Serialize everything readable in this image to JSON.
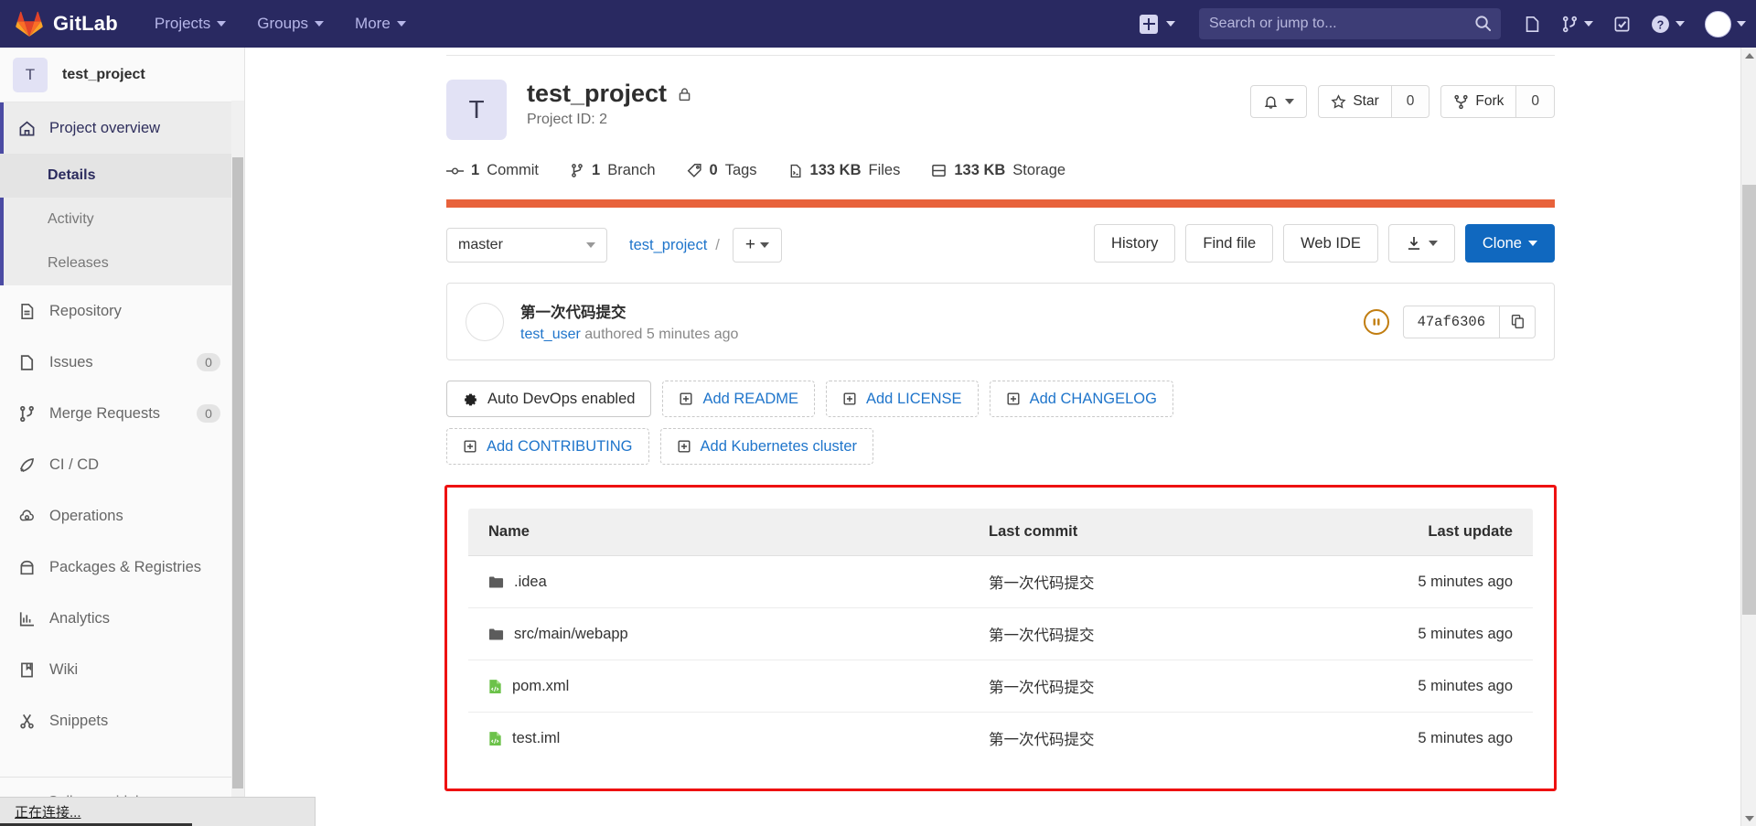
{
  "navbar": {
    "brand": "GitLab",
    "menu": [
      {
        "label": "Projects",
        "name": "nav-projects"
      },
      {
        "label": "Groups",
        "name": "nav-groups"
      },
      {
        "label": "More",
        "name": "nav-more"
      }
    ],
    "search": {
      "placeholder": "Search or jump to...",
      "value": ""
    },
    "icons": [
      "plus-square-icon",
      "search-icon",
      "issues-icon",
      "merge-request-icon",
      "todo-icon",
      "help-icon",
      "user-avatar-icon"
    ]
  },
  "sidebar": {
    "project": {
      "initial": "T",
      "name": "test_project"
    },
    "items": [
      {
        "label": "Project overview",
        "icon": "home-icon",
        "active": true,
        "badge": ""
      },
      {
        "label": "Repository",
        "icon": "document-icon",
        "active": false,
        "badge": ""
      },
      {
        "label": "Issues",
        "icon": "issues-icon",
        "active": false,
        "badge": "0"
      },
      {
        "label": "Merge Requests",
        "icon": "merge-request-icon",
        "active": false,
        "badge": "0"
      },
      {
        "label": "CI / CD",
        "icon": "rocket-icon",
        "active": false,
        "badge": ""
      },
      {
        "label": "Operations",
        "icon": "cloud-gear-icon",
        "active": false,
        "badge": ""
      },
      {
        "label": "Packages & Registries",
        "icon": "package-icon",
        "active": false,
        "badge": ""
      },
      {
        "label": "Analytics",
        "icon": "chart-icon",
        "active": false,
        "badge": ""
      },
      {
        "label": "Wiki",
        "icon": "book-icon",
        "active": false,
        "badge": ""
      },
      {
        "label": "Snippets",
        "icon": "scissors-icon",
        "active": false,
        "badge": ""
      }
    ],
    "subitems": [
      {
        "label": "Details",
        "active": true
      },
      {
        "label": "Activity",
        "active": false
      },
      {
        "label": "Releases",
        "active": false
      }
    ],
    "collapse_label": "Collapse sidebar"
  },
  "project": {
    "initial": "T",
    "title": "test_project",
    "visibility_icon": "lock-icon",
    "id_label": "Project ID: 2",
    "actions": {
      "notification_icon": "bell-icon",
      "star_label": "Star",
      "star_count": "0",
      "fork_label": "Fork",
      "fork_count": "0"
    },
    "stats": [
      {
        "icon": "commit-icon",
        "value": "1",
        "label": "Commit"
      },
      {
        "icon": "branch-icon",
        "value": "1",
        "label": "Branch"
      },
      {
        "icon": "tag-icon",
        "value": "0",
        "label": "Tags"
      },
      {
        "icon": "file-icon",
        "value": "133 KB",
        "label": "Files"
      },
      {
        "icon": "storage-icon",
        "value": "133 KB",
        "label": "Storage"
      }
    ],
    "language_bar_color": "#e8623b"
  },
  "repo_nav": {
    "branch": "master",
    "breadcrumb_root": "test_project",
    "breadcrumb_sep": "/",
    "add_label": "+",
    "buttons": [
      {
        "label": "History",
        "name": "history-button"
      },
      {
        "label": "Find file",
        "name": "find-file-button"
      },
      {
        "label": "Web IDE",
        "name": "web-ide-button"
      }
    ],
    "download_icon": "download-icon",
    "clone_label": "Clone",
    "clone_color": "#1068bf"
  },
  "last_commit": {
    "message": "第一次代码提交",
    "author": "test_user",
    "authored_text": "authored",
    "time": "5 minutes ago",
    "pipeline_status_icon": "pipeline-pending-icon",
    "sha": "47af6306",
    "copy_icon": "copy-icon"
  },
  "quick_actions": [
    {
      "label": "Auto DevOps enabled",
      "icon": "gear-icon",
      "style": "solid"
    },
    {
      "label": "Add README",
      "icon": "plus-box-icon",
      "style": "dashed"
    },
    {
      "label": "Add LICENSE",
      "icon": "plus-box-icon",
      "style": "dashed"
    },
    {
      "label": "Add CHANGELOG",
      "icon": "plus-box-icon",
      "style": "dashed"
    },
    {
      "label": "Add CONTRIBUTING",
      "icon": "plus-box-icon",
      "style": "dashed"
    },
    {
      "label": "Add Kubernetes cluster",
      "icon": "plus-box-icon",
      "style": "dashed"
    }
  ],
  "file_tree": {
    "highlight_color": "#ee1111",
    "columns": [
      "Name",
      "Last commit",
      "Last update"
    ],
    "rows": [
      {
        "name": ".idea",
        "type": "folder",
        "icon": "folder-icon",
        "commit": "第一次代码提交",
        "update": "5 minutes ago"
      },
      {
        "name": "src/main/webapp",
        "type": "folder",
        "icon": "folder-icon",
        "commit": "第一次代码提交",
        "update": "5 minutes ago"
      },
      {
        "name": "pom.xml",
        "type": "file",
        "icon": "xml-file-icon",
        "commit": "第一次代码提交",
        "update": "5 minutes ago"
      },
      {
        "name": "test.iml",
        "type": "file",
        "icon": "xml-file-icon",
        "commit": "第一次代码提交",
        "update": "5 minutes ago"
      }
    ]
  },
  "statusbar": {
    "text": "正在连接..."
  }
}
